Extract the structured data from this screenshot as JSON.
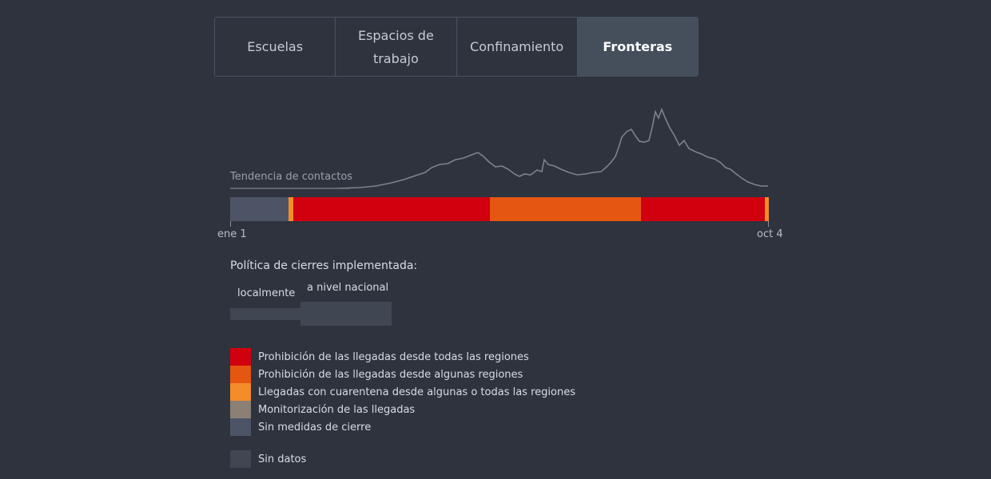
{
  "tabs": [
    {
      "label": "Escuelas",
      "lines": [
        "Escuelas"
      ],
      "active": false
    },
    {
      "label": "Espacios de trabajo",
      "lines": [
        "Espacios de",
        "trabajo"
      ],
      "active": false
    },
    {
      "label": "Confinamiento",
      "lines": [
        "Confinamiento"
      ],
      "active": false
    },
    {
      "label": "Fronteras",
      "lines": [
        "Fronteras"
      ],
      "active": true
    }
  ],
  "trend": {
    "label": "Tendencia de contactos",
    "line_color": "#7d838d"
  },
  "timeline": {
    "start_label": "ene 1",
    "end_label": "oct 4",
    "segments": [
      {
        "category": "Sin medidas de cierre",
        "from_fraction": 0.0,
        "to_fraction": 0.108
      },
      {
        "category": "Llegadas con cuarentena desde algunas o todas las regiones",
        "from_fraction": 0.108,
        "to_fraction": 0.117
      },
      {
        "category": "Prohibición de las llegadas desde todas las regiones",
        "from_fraction": 0.117,
        "to_fraction": 0.482
      },
      {
        "category": "Prohibición de las llegadas desde algunas regiones",
        "from_fraction": 0.482,
        "to_fraction": 0.763
      },
      {
        "category": "Prohibición de las llegadas desde todas las regiones",
        "from_fraction": 0.763,
        "to_fraction": 0.993
      },
      {
        "category": "Llegadas con cuarentena desde algunas o todas las regiones",
        "from_fraction": 0.993,
        "to_fraction": 1.0
      }
    ]
  },
  "policy": {
    "title": "Política de cierres implementada:",
    "local_label": "localmente",
    "national_label": "a nivel nacional"
  },
  "legend": [
    {
      "label": "Prohibición de las llegadas desde todas las regiones",
      "color": "#d0000f"
    },
    {
      "label": "Prohibición de las llegadas desde algunas regiones",
      "color": "#e55611"
    },
    {
      "label": "Llegadas con cuarentena desde algunas o todas las regiones",
      "color": "#f48c2a"
    },
    {
      "label": "Monitorización de las llegadas",
      "color": "#8b7f76"
    },
    {
      "label": "Sin medidas de cierre",
      "color": "#4c5466"
    }
  ],
  "nodata": {
    "label": "Sin datos",
    "color": "#414752"
  }
}
